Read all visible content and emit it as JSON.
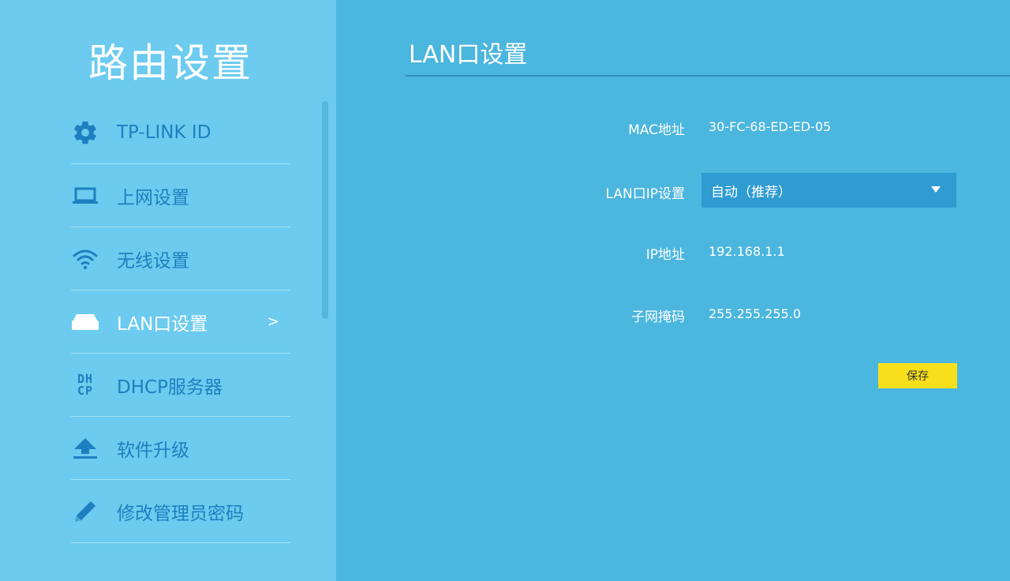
{
  "sidebar": {
    "title": "路由设置",
    "items": [
      {
        "label": "TP-LINK ID",
        "icon": "gear-icon"
      },
      {
        "label": "上网设置",
        "icon": "laptop-icon"
      },
      {
        "label": "无线设置",
        "icon": "wifi-icon"
      },
      {
        "label": "LAN口设置",
        "icon": "router-icon",
        "active": true,
        "chevron": ">"
      },
      {
        "label": "DHCP服务器",
        "icon": "dhcp-icon",
        "icon_text_top": "DH",
        "icon_text_bottom": "CP"
      },
      {
        "label": "软件升级",
        "icon": "upload-icon"
      },
      {
        "label": "修改管理员密码",
        "icon": "pencil-icon"
      }
    ]
  },
  "main": {
    "title": "LAN口设置",
    "fields": {
      "mac": {
        "label": "MAC地址",
        "value": "30-FC-68-ED-ED-05"
      },
      "lan_ip_mode": {
        "label": "LAN口IP设置",
        "value": "自动（推荐）"
      },
      "ip": {
        "label": "IP地址",
        "value": "192.168.1.1"
      },
      "mask": {
        "label": "子网掩码",
        "value": "255.255.255.0"
      }
    },
    "save_label": "保存"
  },
  "colors": {
    "sidebar_bg": "#6ccbee",
    "main_bg": "#4bb6de",
    "accent_text": "#1e7fc0",
    "save_button": "#f7e01b"
  }
}
